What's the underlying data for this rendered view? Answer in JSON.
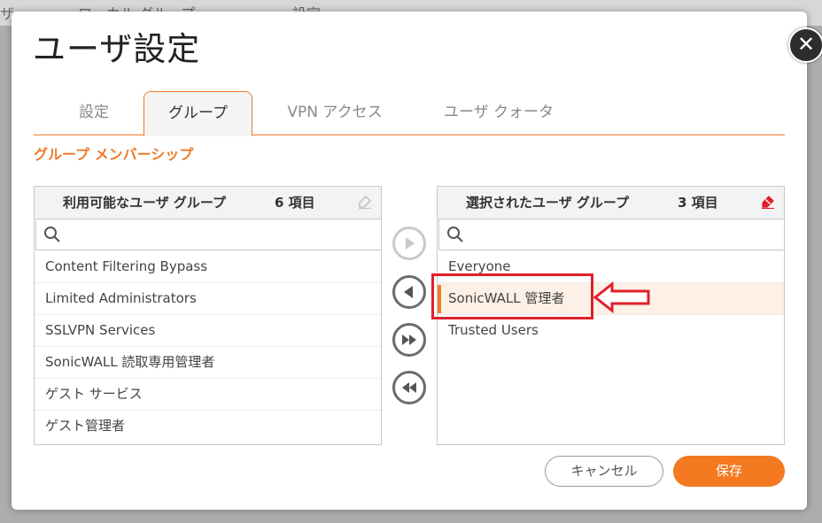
{
  "background": {
    "crumbs": [
      "ザ",
      "ローカル グループ",
      "設定"
    ]
  },
  "modal": {
    "title": "ユーザ設定",
    "close_icon": "close-icon",
    "tabs": [
      {
        "label": "設定",
        "active": false
      },
      {
        "label": "グループ",
        "active": true
      },
      {
        "label": "VPN アクセス",
        "active": false
      },
      {
        "label": "ユーザ クォータ",
        "active": false
      }
    ],
    "section_title": "グループ メンバーシップ"
  },
  "available": {
    "title": "利用可能なユーザ グループ",
    "count": "6 項目",
    "search_placeholder": "",
    "items": [
      "Content Filtering Bypass",
      "Limited Administrators",
      "SSLVPN Services",
      "SonicWALL 読取専用管理者",
      "ゲスト サービス",
      "ゲスト管理者"
    ]
  },
  "selected": {
    "title": "選択されたユーザ グループ",
    "count": "3 項目",
    "search_placeholder": "",
    "items": [
      {
        "label": "Everyone",
        "selected": false
      },
      {
        "label": "SonicWALL 管理者",
        "selected": true
      },
      {
        "label": "Trusted Users",
        "selected": false
      }
    ]
  },
  "transfer_buttons": [
    {
      "icon": "move-right-icon",
      "enabled": false
    },
    {
      "icon": "move-left-icon",
      "enabled": true
    },
    {
      "icon": "move-all-right-icon",
      "enabled": true
    },
    {
      "icon": "move-all-left-icon",
      "enabled": true
    }
  ],
  "footer": {
    "cancel_label": "キャンセル",
    "save_label": "保存"
  },
  "colors": {
    "accent": "#f07b2a",
    "save": "#f47920",
    "annotation": "#e0202a"
  }
}
